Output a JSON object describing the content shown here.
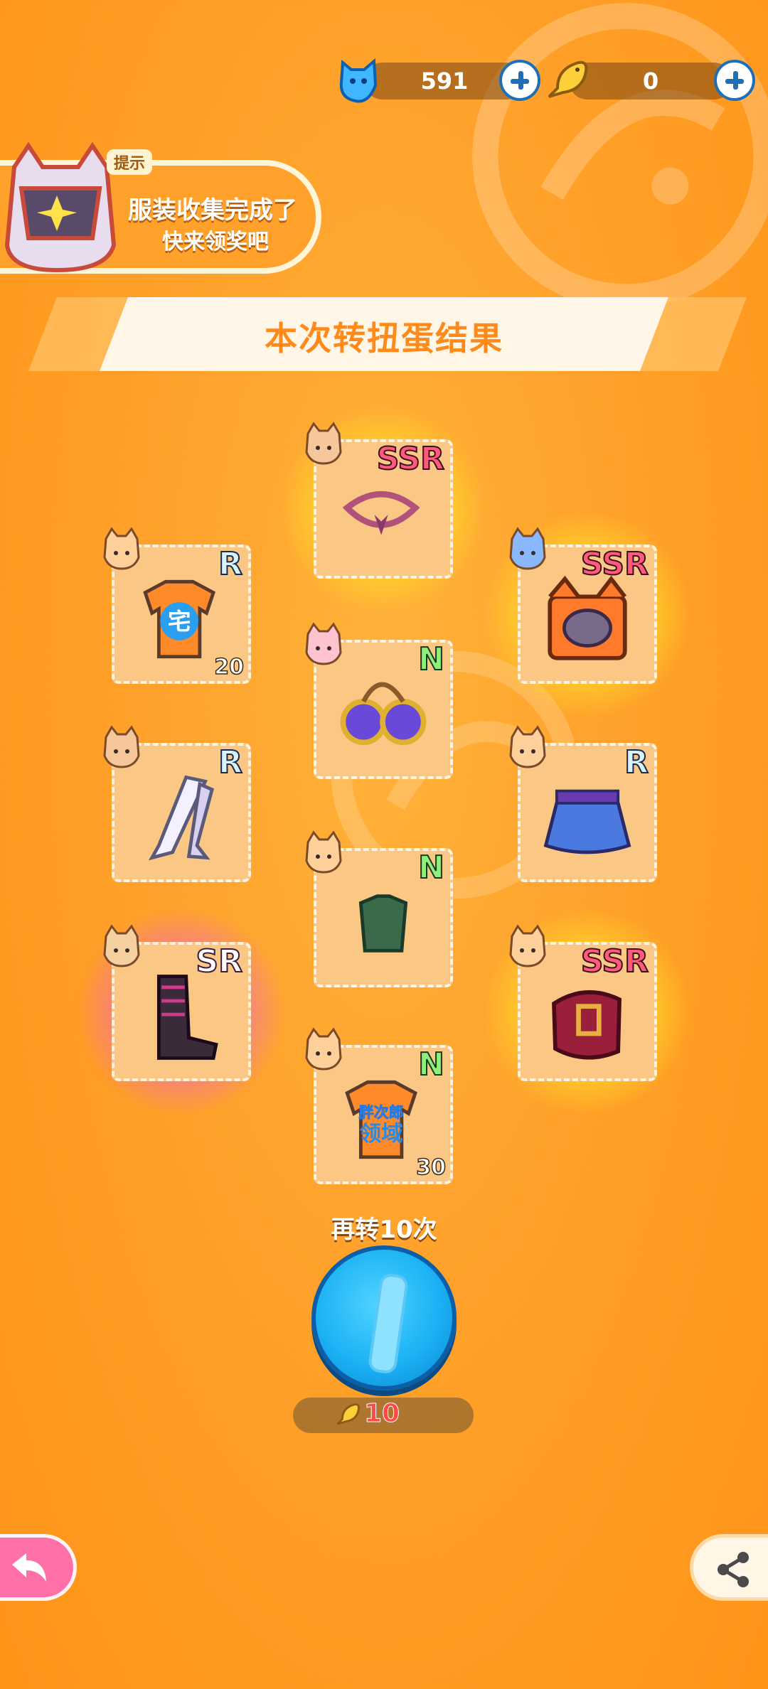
{
  "currency": {
    "gems": "591",
    "fish": "0",
    "gem_icon": "blue-cat-gem-icon",
    "fish_icon": "golden-fish-icon"
  },
  "tip": {
    "tag": "提示",
    "line1": "服装收集完成了",
    "line2": "快来领奖吧"
  },
  "banner": {
    "title": "本次转扭蛋结果"
  },
  "items": [
    {
      "id": "rope-necklace",
      "rarity": "SSR",
      "icon": "rope-necklace-icon",
      "count": ""
    },
    {
      "id": "otaku-shirt",
      "rarity": "R",
      "icon": "otaku-shirt-icon",
      "count": "20"
    },
    {
      "id": "cat-crate",
      "rarity": "SSR",
      "icon": "cat-crate-icon",
      "count": ""
    },
    {
      "id": "goggles",
      "rarity": "N",
      "icon": "goggles-icon",
      "count": ""
    },
    {
      "id": "stockings",
      "rarity": "R",
      "icon": "stockings-icon",
      "count": ""
    },
    {
      "id": "skirt",
      "rarity": "R",
      "icon": "skirt-icon",
      "count": ""
    },
    {
      "id": "green-shirt",
      "rarity": "N",
      "icon": "green-shirt-icon",
      "count": ""
    },
    {
      "id": "boots",
      "rarity": "SR",
      "icon": "boots-icon",
      "count": ""
    },
    {
      "id": "belt-bag",
      "rarity": "SSR",
      "icon": "belt-bag-icon",
      "count": ""
    },
    {
      "id": "domain-shirt",
      "rarity": "N",
      "icon": "domain-shirt-icon",
      "count": "30",
      "shirt_text1": "胖次郎",
      "shirt_text2": "领域"
    }
  ],
  "otaku_char": "宅",
  "spin": {
    "label": "再转10次",
    "cost": "10"
  },
  "colors": {
    "background": "#ffa12a",
    "ssr": "#ff5a7a",
    "n": "#8df07a",
    "spin": "#1cb2f5"
  }
}
